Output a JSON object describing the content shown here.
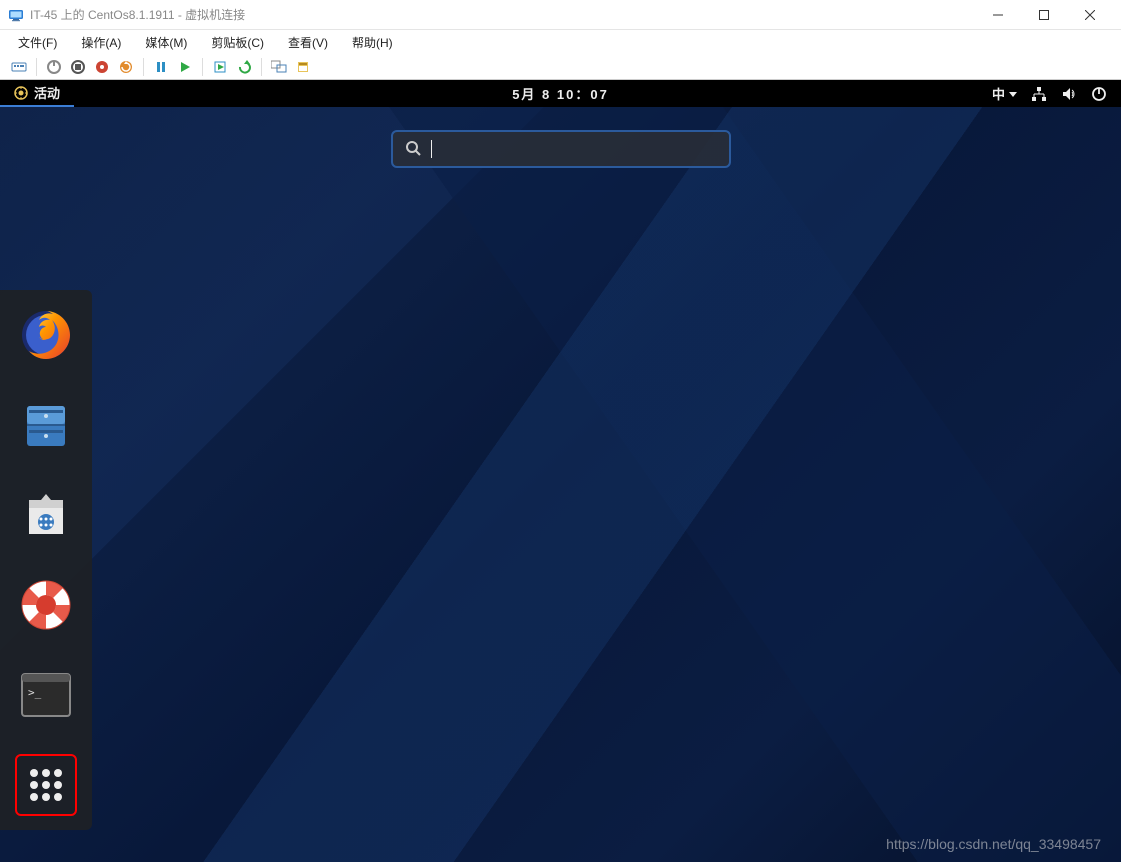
{
  "hyperv": {
    "window_title": "IT-45 上的 CentOs8.1.1911 - 虚拟机连接",
    "menus": {
      "file": "文件(F)",
      "action": "操作(A)",
      "media": "媒体(M)",
      "clipboard": "剪贴板(C)",
      "view": "查看(V)",
      "help": "帮助(H)"
    },
    "toolbar_icons": [
      "ctrl-alt-del-icon",
      "power-off-icon",
      "shutdown-icon",
      "stop-icon",
      "reset-icon",
      "pause-icon",
      "start-icon",
      "checkpoint-icon",
      "revert-icon",
      "enhanced-session-icon",
      "share-icon"
    ]
  },
  "gnome": {
    "activities_label": "活动",
    "clock": "5月 8 10：07",
    "ime_label": "中",
    "search_placeholder": "",
    "dock": [
      {
        "name": "firefox",
        "label": "Firefox"
      },
      {
        "name": "files",
        "label": "文件"
      },
      {
        "name": "software",
        "label": "软件"
      },
      {
        "name": "help",
        "label": "帮助"
      },
      {
        "name": "terminal",
        "label": "终端"
      },
      {
        "name": "app-grid",
        "label": "显示应用程序",
        "highlighted": true
      }
    ]
  },
  "watermark": "https://blog.csdn.net/qq_33498457"
}
